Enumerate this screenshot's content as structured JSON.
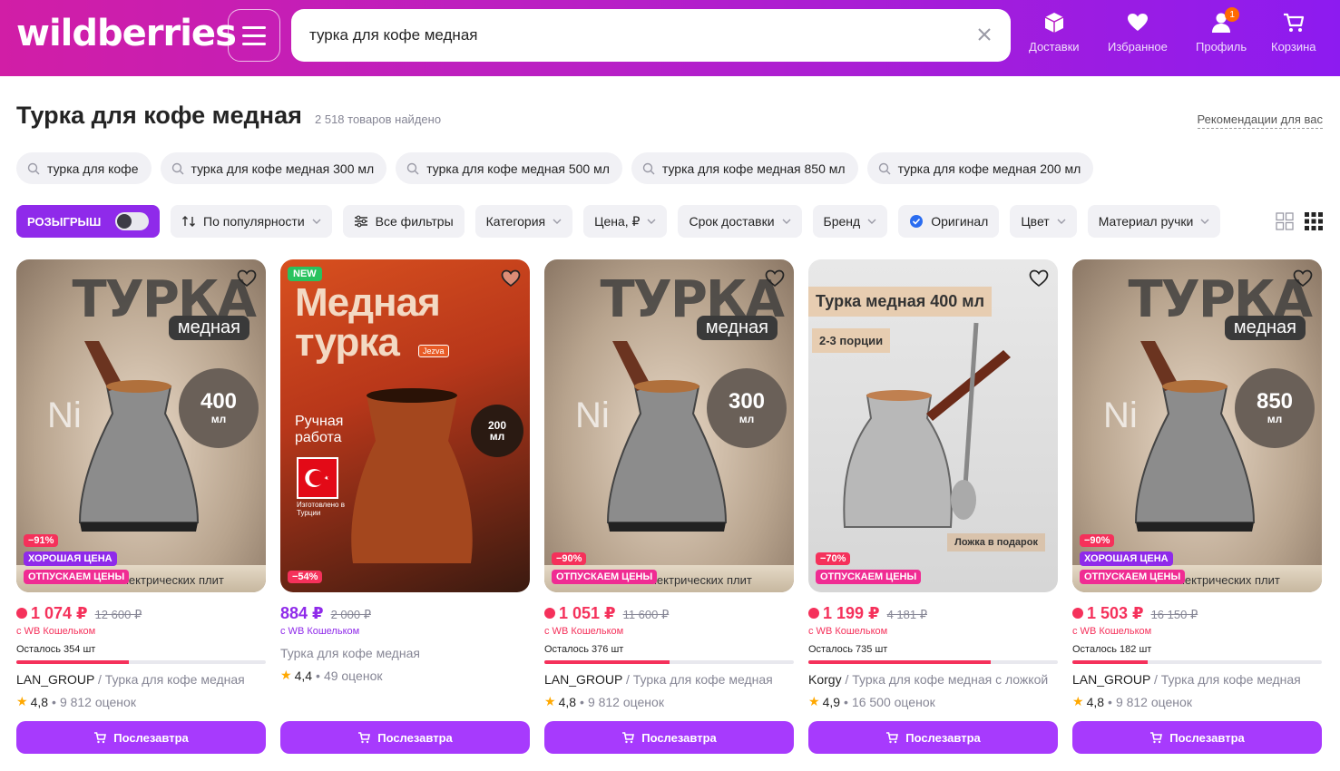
{
  "header": {
    "logo": "wildberries",
    "search_value": "турка для кофе медная",
    "nav": [
      {
        "label": "Доставки"
      },
      {
        "label": "Избранное"
      },
      {
        "label": "Профиль",
        "badge": "1"
      },
      {
        "label": "Корзина"
      }
    ]
  },
  "page": {
    "title": "Турка для кофе медная",
    "found": "2 518 товаров найдено",
    "recommendations": "Рекомендации для вас"
  },
  "suggestions": [
    "турка для кофе",
    "турка для кофе медная 300 мл",
    "турка для кофе медная 500 мл",
    "турка для кофе медная 850 мл",
    "турка для кофе медная 200 мл"
  ],
  "filters": {
    "raffle": "РОЗЫГРЫШ",
    "sort": "По популярности",
    "all": "Все фильтры",
    "category": "Категория",
    "price": "Цена, ₽",
    "delivery": "Срок доставки",
    "brand": "Бренд",
    "original": "Оригинал",
    "color": "Цвет",
    "handle": "Материал ручки"
  },
  "labels": {
    "good_price": "ХОРОШАЯ ЦЕНА",
    "release": "ОТПУСКАЕМ ЦЕНЫ",
    "new": "NEW",
    "cart_button": "Послезавтра",
    "wallet": "с WB Кошельком",
    "electric": "электрических плит"
  },
  "products": [
    {
      "discount": "−91%",
      "price": "1 074 ₽",
      "old_price": "12 600 ₽",
      "stock": "Осталось 354 шт",
      "stock_fraction": 0.45,
      "brand": "LAN_GROUP",
      "name": "Турка для кофе медная",
      "rating": "4,8",
      "reviews": "9 812 оценок",
      "image": {
        "title": "ТУРКА",
        "subtitle": "медная",
        "volume": "400",
        "unit": "мл",
        "ni": "Ni"
      }
    },
    {
      "discount": "−54%",
      "price": "884 ₽",
      "old_price": "2 000 ₽",
      "name": "Турка для кофе медная",
      "rating": "4,4",
      "reviews": "49 оценок",
      "image": {
        "title": "Медная турка",
        "hand": "Ручная работа",
        "volume": "200",
        "unit": "мл",
        "brand_tag": "Jezva",
        "made_in": "Изготовлено в Турции"
      }
    },
    {
      "discount": "−90%",
      "price": "1 051 ₽",
      "old_price": "11 600 ₽",
      "stock": "Осталось 376 шт",
      "stock_fraction": 0.5,
      "brand": "LAN_GROUP",
      "name": "Турка для кофе медная",
      "rating": "4,8",
      "reviews": "9 812 оценок",
      "image": {
        "title": "ТУРКА",
        "subtitle": "медная",
        "volume": "300",
        "unit": "мл",
        "ni": "Ni"
      }
    },
    {
      "discount": "−70%",
      "price": "1 199 ₽",
      "old_price": "4 181 ₽",
      "stock": "Осталось 735 шт",
      "stock_fraction": 0.73,
      "brand": "Korgy",
      "name": "Турка для кофе медная с ложкой",
      "rating": "4,9",
      "reviews": "16 500 оценок",
      "image": {
        "title": "Турка медная 400 мл",
        "portions": "2-3 порции",
        "gift": "Ложка в подарок"
      }
    },
    {
      "discount": "−90%",
      "price": "1 503 ₽",
      "old_price": "16 150 ₽",
      "stock": "Осталось 182 шт",
      "stock_fraction": 0.3,
      "brand": "LAN_GROUP",
      "name": "Турка для кофе медная",
      "rating": "4,8",
      "reviews": "9 812 оценок",
      "image": {
        "title": "ТУРКА",
        "subtitle": "медная",
        "volume": "850",
        "unit": "мл",
        "ni": "Ni"
      }
    }
  ]
}
